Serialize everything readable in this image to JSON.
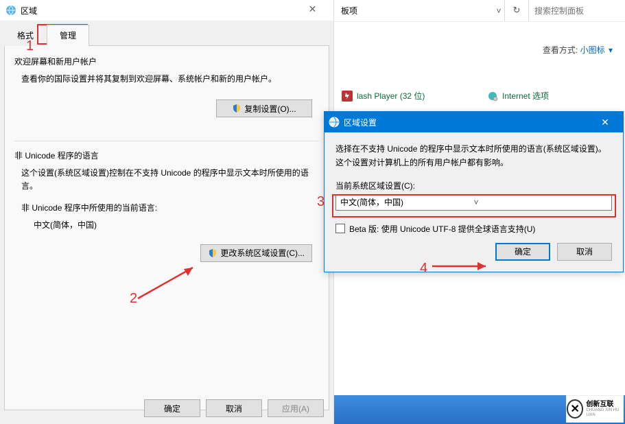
{
  "regionDialog": {
    "title": "区域",
    "tabs": {
      "format": "格式",
      "manage": "管理"
    },
    "welcomeSection": {
      "title": "欢迎屏幕和新用户帐户",
      "text": "查看你的国际设置并将其复制到欢迎屏幕、系统帐户和新的用户帐户。",
      "button": "复制设置(O)..."
    },
    "nonUnicodeSection": {
      "title": "非 Unicode 程序的语言",
      "text": "这个设置(系统区域设置)控制在不支持 Unicode 的程序中显示文本时所使用的语言。",
      "curLabel": "非 Unicode 程序中所使用的当前语言:",
      "curValue": "中文(简体，中国)",
      "button": "更改系统区域设置(C)..."
    },
    "buttons": {
      "ok": "确定",
      "cancel": "取消",
      "apply": "应用(A)"
    }
  },
  "controlPanel": {
    "addrTail": "板项",
    "searchPlaceholder": "搜索控制面板",
    "viewLabel": "查看方式:",
    "viewValue": "小图标",
    "items": {
      "flash": "lash Player (32 位)",
      "internet": "Internet 选项"
    }
  },
  "modal": {
    "title": "区域设置",
    "text": "选择在不支持 Unicode 的程序中显示文本时所使用的语言(系统区域设置)。这个设置对计算机上的所有用户帐户都有影响。",
    "label": "当前系统区域设置(C):",
    "selectValue": "中文(简体，中国)",
    "checkbox": "Beta 版: 使用 Unicode UTF-8 提供全球语言支持(U)",
    "ok": "确定",
    "cancel": "取消"
  },
  "annotations": {
    "n1": "1",
    "n2": "2",
    "n3": "3",
    "n4": "4"
  },
  "logo": {
    "cn": "创新互联",
    "en": "CHUANG XIN HU LIAN"
  }
}
